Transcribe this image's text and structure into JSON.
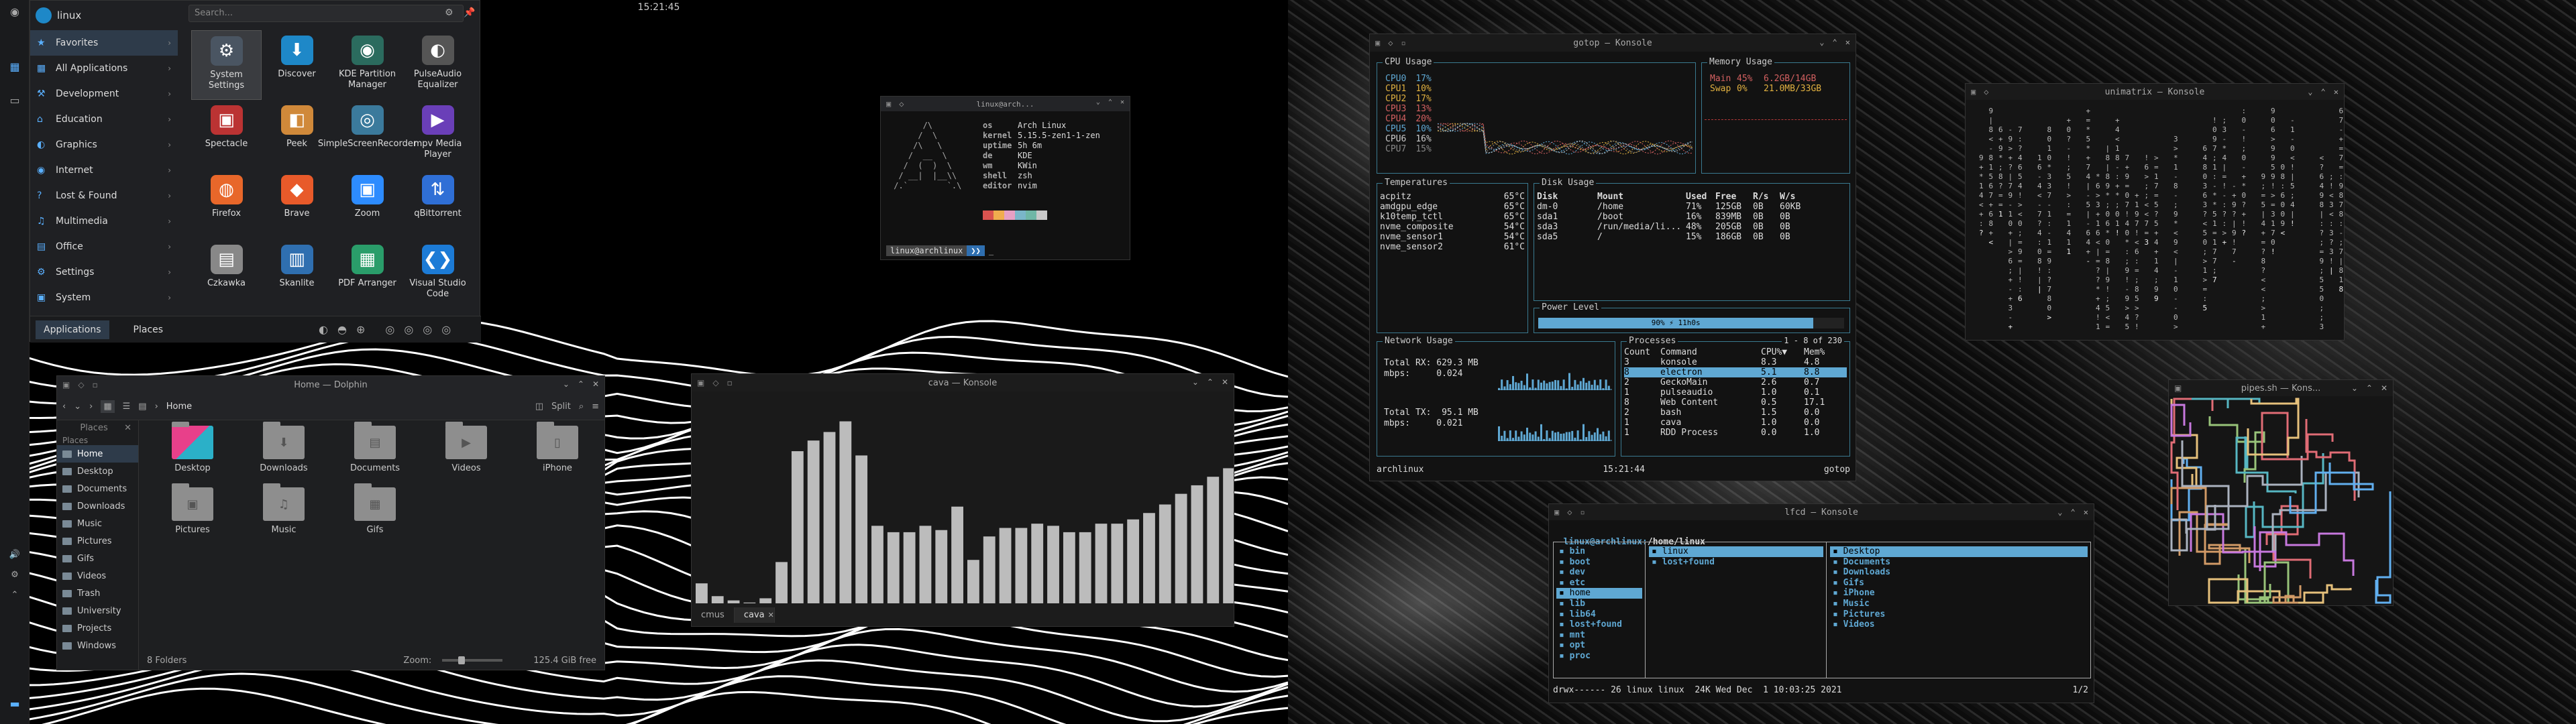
{
  "topbar": {
    "clock": "15:21:45"
  },
  "launcher": {
    "user": "linux",
    "search_placeholder": "Search...",
    "categories": [
      "Favorites",
      "All Applications",
      "Development",
      "Education",
      "Graphics",
      "Internet",
      "Lost & Found",
      "Multimedia",
      "Office",
      "Settings",
      "System"
    ],
    "apps": [
      "System Settings",
      "Discover",
      "KDE Partition Manager",
      "PulseAudio Equalizer",
      "Spectacle",
      "Peek",
      "SimpleScreenRecorder",
      "mpv Media Player",
      "Firefox",
      "Brave",
      "Zoom",
      "qBittorrent",
      "Czkawka",
      "Skanlite",
      "PDF Arranger",
      "Visual Studio Code"
    ],
    "tabs": [
      "Applications",
      "Places"
    ]
  },
  "dolphin": {
    "title": "Home — Dolphin",
    "breadcrumb": "Home",
    "split": "Split",
    "places_header": "Places",
    "places": [
      "Home",
      "Desktop",
      "Documents",
      "Downloads",
      "Music",
      "Pictures",
      "Gifs",
      "Videos",
      "Trash",
      "University",
      "Projects",
      "Windows"
    ],
    "files": [
      "Desktop",
      "Downloads",
      "Documents",
      "Videos",
      "iPhone",
      "Pictures",
      "Music",
      "Gifs"
    ],
    "status_count": "8 Folders",
    "zoom_label": "Zoom:",
    "free": "125.4 GiB free"
  },
  "cava": {
    "title": "cava — Konsole",
    "tabs": [
      "cmus",
      "cava"
    ],
    "bars": [
      10,
      4,
      2,
      1,
      3,
      20,
      72,
      77,
      81,
      86,
      70,
      37,
      34,
      34,
      37,
      35,
      46,
      21,
      32,
      36,
      36,
      38,
      37,
      34,
      34,
      38,
      38,
      40,
      43,
      47,
      52,
      56,
      60,
      64
    ]
  },
  "neofetch": {
    "title": "linux@arch...",
    "rows": [
      [
        "os",
        "Arch Linux"
      ],
      [
        "kernel",
        "5.15.5-zen1-1-zen"
      ],
      [
        "uptime",
        "5h 6m"
      ],
      [
        "de",
        "KDE"
      ],
      [
        "wm",
        "KWin"
      ],
      [
        "shell",
        "zsh"
      ],
      [
        "editor",
        "nvim"
      ]
    ],
    "prompt": "linux@archlinux",
    "palette": [
      "#d9534f",
      "#f0ad4e",
      "#e6a0c4",
      "#7ab6c9",
      "#6fb7a6",
      "#c9c9c9"
    ]
  },
  "gotop": {
    "title": "gotop — Konsole",
    "cpu_title": "CPU Usage",
    "cpus": [
      [
        "CPU0",
        "17%"
      ],
      [
        "CPU1",
        "10%"
      ],
      [
        "CPU2",
        "17%"
      ],
      [
        "CPU3",
        "13%"
      ],
      [
        "CPU4",
        "20%"
      ],
      [
        "CPU5",
        "10%"
      ],
      [
        "CPU6",
        "16%"
      ],
      [
        "CPU7",
        "15%"
      ]
    ],
    "mem_title": "Memory Usage",
    "mem": [
      [
        "Main",
        "45%",
        "6.2GB/14GB"
      ],
      [
        "Swap",
        "0%",
        "21.0MB/33GB"
      ]
    ],
    "temp_title": "Temperatures",
    "temps": [
      [
        "acpitz",
        "65°C"
      ],
      [
        "amdgpu_edge",
        "65°C"
      ],
      [
        "k10temp_tctl",
        "65°C"
      ],
      [
        "nvme_composite",
        "54°C"
      ],
      [
        "nvme_sensor1",
        "54°C"
      ],
      [
        "nvme_sensor2",
        "61°C"
      ]
    ],
    "disk_title": "Disk Usage",
    "disk_head": [
      "Disk",
      "Mount",
      "Used",
      "Free",
      "R/s",
      "W/s"
    ],
    "disks": [
      [
        "dm-0",
        "/home",
        "71%",
        "125GB",
        "0B",
        "60KB"
      ],
      [
        "sda1",
        "/boot",
        "16%",
        "839MB",
        "0B",
        "0B"
      ],
      [
        "sda3",
        "/run/media/li...",
        "48%",
        "205GB",
        "0B",
        "0B"
      ],
      [
        "sda5",
        "/",
        "15%",
        "186GB",
        "0B",
        "0B"
      ]
    ],
    "power_title": "Power Level",
    "power": "90% ⚡ 11h0s",
    "power_pct": 0.9,
    "net_title": "Network Usage",
    "net": {
      "rx_total": "Total RX: 629.3 MB",
      "rx_rate": "mbps:     0.024",
      "tx_total": "Total TX:  95.1 MB",
      "tx_rate": "mbps:     0.021"
    },
    "proc_title": "Processes",
    "proc_range": "1 - 8 of 230",
    "proc_head": [
      "Count",
      "Command",
      "CPU%▼",
      "Mem%"
    ],
    "procs": [
      [
        "3",
        "konsole",
        "8.3",
        "4.8"
      ],
      [
        "8",
        "electron",
        "5.1",
        "8.8"
      ],
      [
        "2",
        "GeckoMain",
        "2.6",
        "0.7"
      ],
      [
        "1",
        "pulseaudio",
        "1.0",
        "0.1"
      ],
      [
        "8",
        "Web Content",
        "0.5",
        "17.1"
      ],
      [
        "2",
        "bash",
        "1.5",
        "0.0"
      ],
      [
        "1",
        "cava",
        "1.0",
        "0.0"
      ],
      [
        "1",
        "RDD Process",
        "0.0",
        "1.0"
      ]
    ],
    "footer_left": "archlinux",
    "footer_time": "15:21:44",
    "footer_right": "gotop"
  },
  "matrix": {
    "title": "unimatrix — Konsole"
  },
  "pipes": {
    "title": "pipes.sh — Kons..."
  },
  "lf": {
    "title": "lfcd — Konsole",
    "path_user": "linux@archlinux:",
    "path": "/home/linux",
    "col1": [
      "bin",
      "boot",
      "dev",
      "etc",
      "home",
      "lib",
      "lib64",
      "lost+found",
      "mnt",
      "opt",
      "proc"
    ],
    "col2": [
      "linux",
      "lost+found"
    ],
    "col3": [
      "Desktop",
      "Documents",
      "Downloads",
      "Gifs",
      "iPhone",
      "Music",
      "Pictures",
      "Videos"
    ],
    "status": "drwx------ 26 linux linux  24K Wed Dec  1 10:03:25 2021",
    "page": "1/2"
  }
}
